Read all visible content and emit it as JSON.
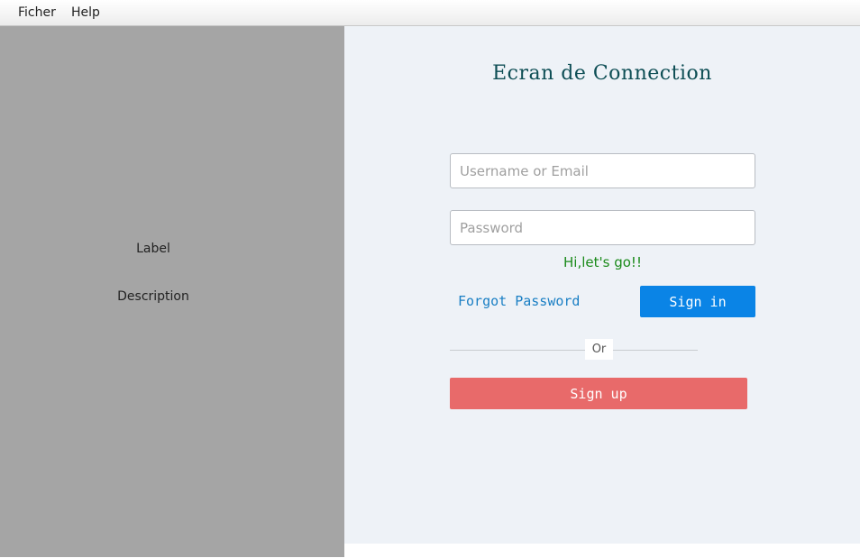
{
  "menubar": {
    "items": [
      {
        "label": "Ficher"
      },
      {
        "label": "Help"
      }
    ]
  },
  "left_panel": {
    "label": "Label",
    "description": "Description"
  },
  "login": {
    "title": "Ecran de Connection",
    "username_placeholder": "Username or Email",
    "username_value": "",
    "password_placeholder": "Password",
    "password_value": "",
    "greeting": "Hi,let's go!!",
    "forgot_password": "Forgot Password",
    "sign_in": "Sign in",
    "or": "Or",
    "sign_up": "Sign up"
  },
  "colors": {
    "left_panel_bg": "#a5a5a5",
    "right_panel_bg": "#eef2f7",
    "title": "#0e4e55",
    "greeting": "#1a8a1a",
    "link": "#1a7fc4",
    "sign_in_bg": "#0a84e6",
    "sign_up_bg": "#e86a6a"
  }
}
